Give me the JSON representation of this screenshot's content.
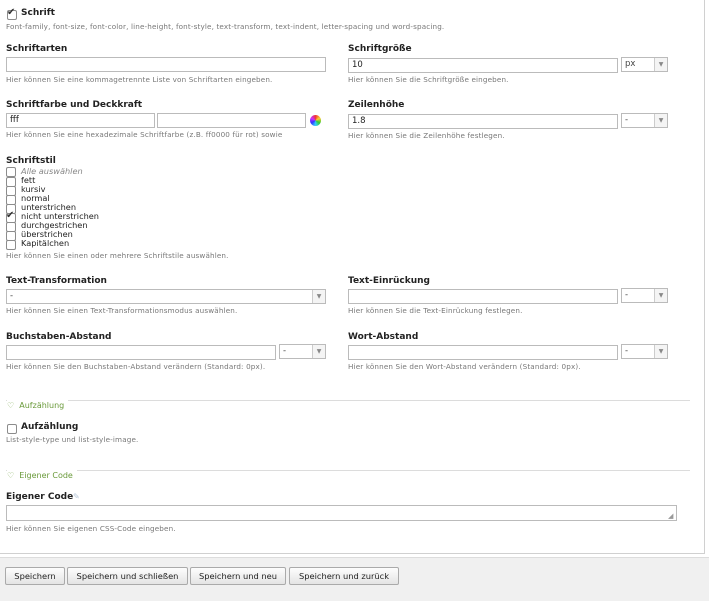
{
  "font_section": {
    "checkbox_label": "Schrift",
    "checked": true,
    "description": "Font-family, font-size, font-color, line-height, font-style, text-transform, text-indent, letter-spacing und word-spacing."
  },
  "schriftarten": {
    "label": "Schriftarten",
    "value": "",
    "help": "Hier können Sie eine kommagetrennte Liste von Schriftarten eingeben."
  },
  "schriftgroesse": {
    "label": "Schriftgröße",
    "value": "10",
    "unit": "px",
    "help": "Hier können Sie die Schriftgröße eingeben."
  },
  "schriftfarbe": {
    "label": "Schriftfarbe und Deckkraft",
    "value": "fff",
    "opacity_value": "",
    "help": "Hier können Sie eine hexadezimale Schriftfarbe (z.B. ff0000 für rot) sowie"
  },
  "zeilenhoehe": {
    "label": "Zeilenhöhe",
    "value": "1.8",
    "unit": "-",
    "help": "Hier können Sie die Zeilenhöhe festlegen."
  },
  "schriftstil": {
    "label": "Schriftstil",
    "select_all": "Alle auswählen",
    "options": [
      {
        "label": "fett",
        "checked": false
      },
      {
        "label": "kursiv",
        "checked": false
      },
      {
        "label": "normal",
        "checked": false
      },
      {
        "label": "unterstrichen",
        "checked": false
      },
      {
        "label": "nicht unterstrichen",
        "checked": true
      },
      {
        "label": "durchgestrichen",
        "checked": false
      },
      {
        "label": "überstrichen",
        "checked": false
      },
      {
        "label": "Kapitälchen",
        "checked": false
      }
    ],
    "help": "Hier können Sie einen oder mehrere Schriftstile auswählen."
  },
  "text_transformation": {
    "label": "Text-Transformation",
    "value": "-",
    "help": "Hier können Sie einen Text-Transformationsmodus auswählen."
  },
  "text_einrueckung": {
    "label": "Text-Einrückung",
    "value": "",
    "unit": "-",
    "help": "Hier können Sie die Text-Einrückung festlegen."
  },
  "buchstaben_abstand": {
    "label": "Buchstaben-Abstand",
    "value": "",
    "unit": "-",
    "help": "Hier können Sie den Buchstaben-Abstand verändern (Standard: 0px)."
  },
  "wort_abstand": {
    "label": "Wort-Abstand",
    "value": "",
    "unit": "-",
    "help": "Hier können Sie den Wort-Abstand verändern (Standard: 0px)."
  },
  "aufzaehlung_fieldset": {
    "legend": "Aufzählung",
    "checkbox_label": "Aufzählung",
    "checked": false,
    "description": "List-style-type und list-style-image."
  },
  "eigener_code_fieldset": {
    "legend": "Eigener Code",
    "label": "Eigener Code",
    "value": "",
    "help": "Hier können Sie eigenen CSS-Code eingeben."
  },
  "buttons": {
    "save": "Speichern",
    "save_close": "Speichern und schließen",
    "save_new": "Speichern und neu",
    "save_back": "Speichern und zurück"
  },
  "icons": {
    "fieldset_toggle": "heart-outline-icon",
    "color_picker": "color-wheel-icon",
    "code_editor": "brush-icon",
    "dropdown": "chevron-down-icon"
  }
}
